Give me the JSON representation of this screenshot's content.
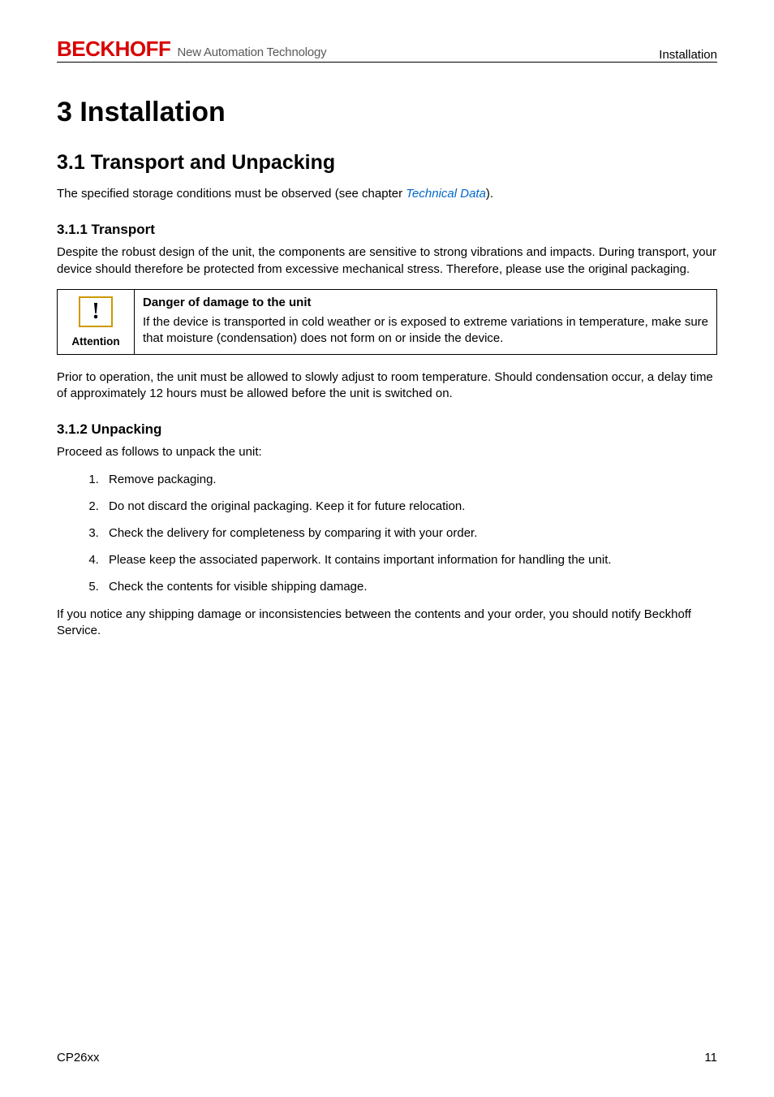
{
  "header": {
    "logo_brand": "BECKHOFF",
    "logo_tagline": "New Automation Technology",
    "section_label": "Installation"
  },
  "chapter_title": "3  Installation",
  "section_3_1": {
    "title": "3.1 Transport and Unpacking",
    "intro_prefix": "The specified storage conditions must be observed (see chapter ",
    "intro_link": "Technical Data",
    "intro_suffix": ")."
  },
  "section_3_1_1": {
    "title": "3.1.1  Transport",
    "para": "Despite the robust design of the unit, the components are sensitive to strong vibrations and impacts. During transport, your device should therefore be protected from excessive mechanical stress. Therefore, please use the original packaging."
  },
  "attention": {
    "label": "Attention",
    "title": "Danger of damage to the unit",
    "body": "If the device is transported in cold weather or is exposed to extreme variations in temperature, make sure that moisture (condensation) does not form on or inside the device."
  },
  "after_attention_para": "Prior to operation, the unit must be allowed to slowly adjust to room temperature. Should condensation occur, a delay time of approximately 12 hours must be allowed before the unit is switched on.",
  "section_3_1_2": {
    "title": "3.1.2  Unpacking",
    "intro": "Proceed as follows to unpack the unit:",
    "steps": [
      "Remove packaging.",
      "Do not discard the original packaging. Keep it for future relocation.",
      "Check the delivery for completeness by comparing it with your order.",
      "Please keep the associated paperwork. It contains important information for handling the unit.",
      "Check the contents for visible shipping damage."
    ],
    "closing": "If you notice any shipping damage or inconsistencies between the contents and your order, you should notify Beckhoff Service."
  },
  "footer": {
    "doc_code": "CP26xx",
    "page_num": "11"
  }
}
